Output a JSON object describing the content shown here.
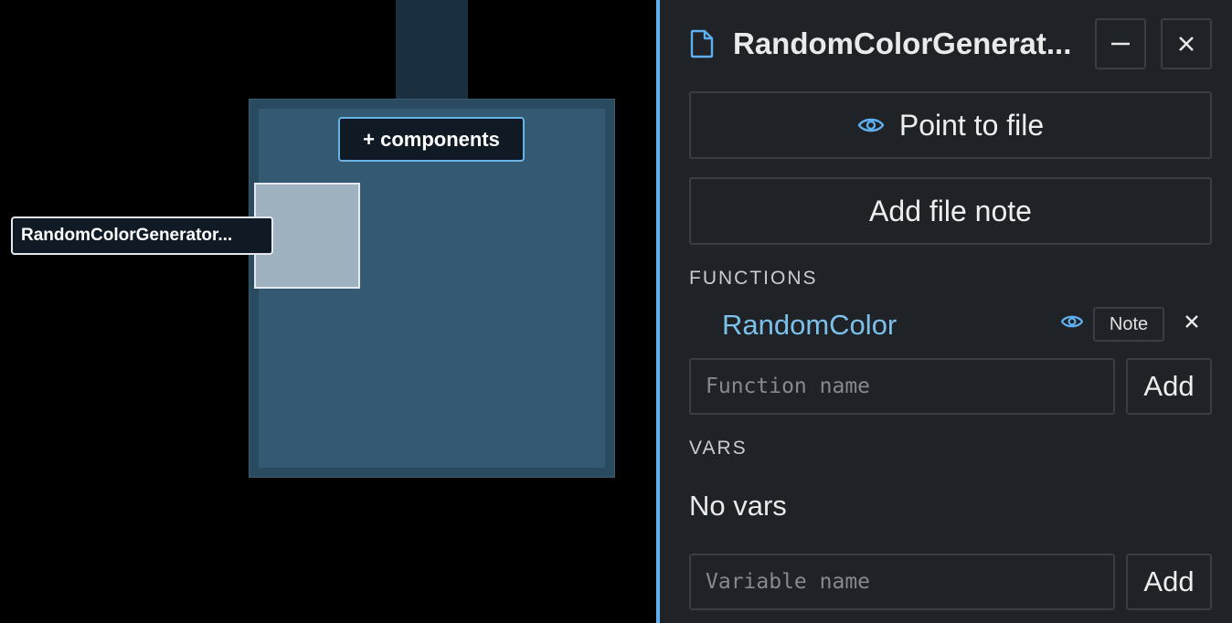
{
  "canvas": {
    "directory_label": "+ components",
    "file_label": "RandomColorGenerator..."
  },
  "panel": {
    "title": "RandomColorGenerat...",
    "point_to_file": "Point to file",
    "add_file_note": "Add file note",
    "functions_label": "FUNCTIONS",
    "functions": [
      {
        "name": "RandomColor",
        "note_label": "Note"
      }
    ],
    "function_placeholder": "Function name",
    "function_add": "Add",
    "vars_label": "VARS",
    "no_vars": "No vars",
    "variable_placeholder": "Variable name",
    "variable_add": "Add"
  },
  "colors": {
    "accent": "#5fb0f0",
    "function_name": "#7cc0ea",
    "panel_bg": "#1f2226"
  }
}
